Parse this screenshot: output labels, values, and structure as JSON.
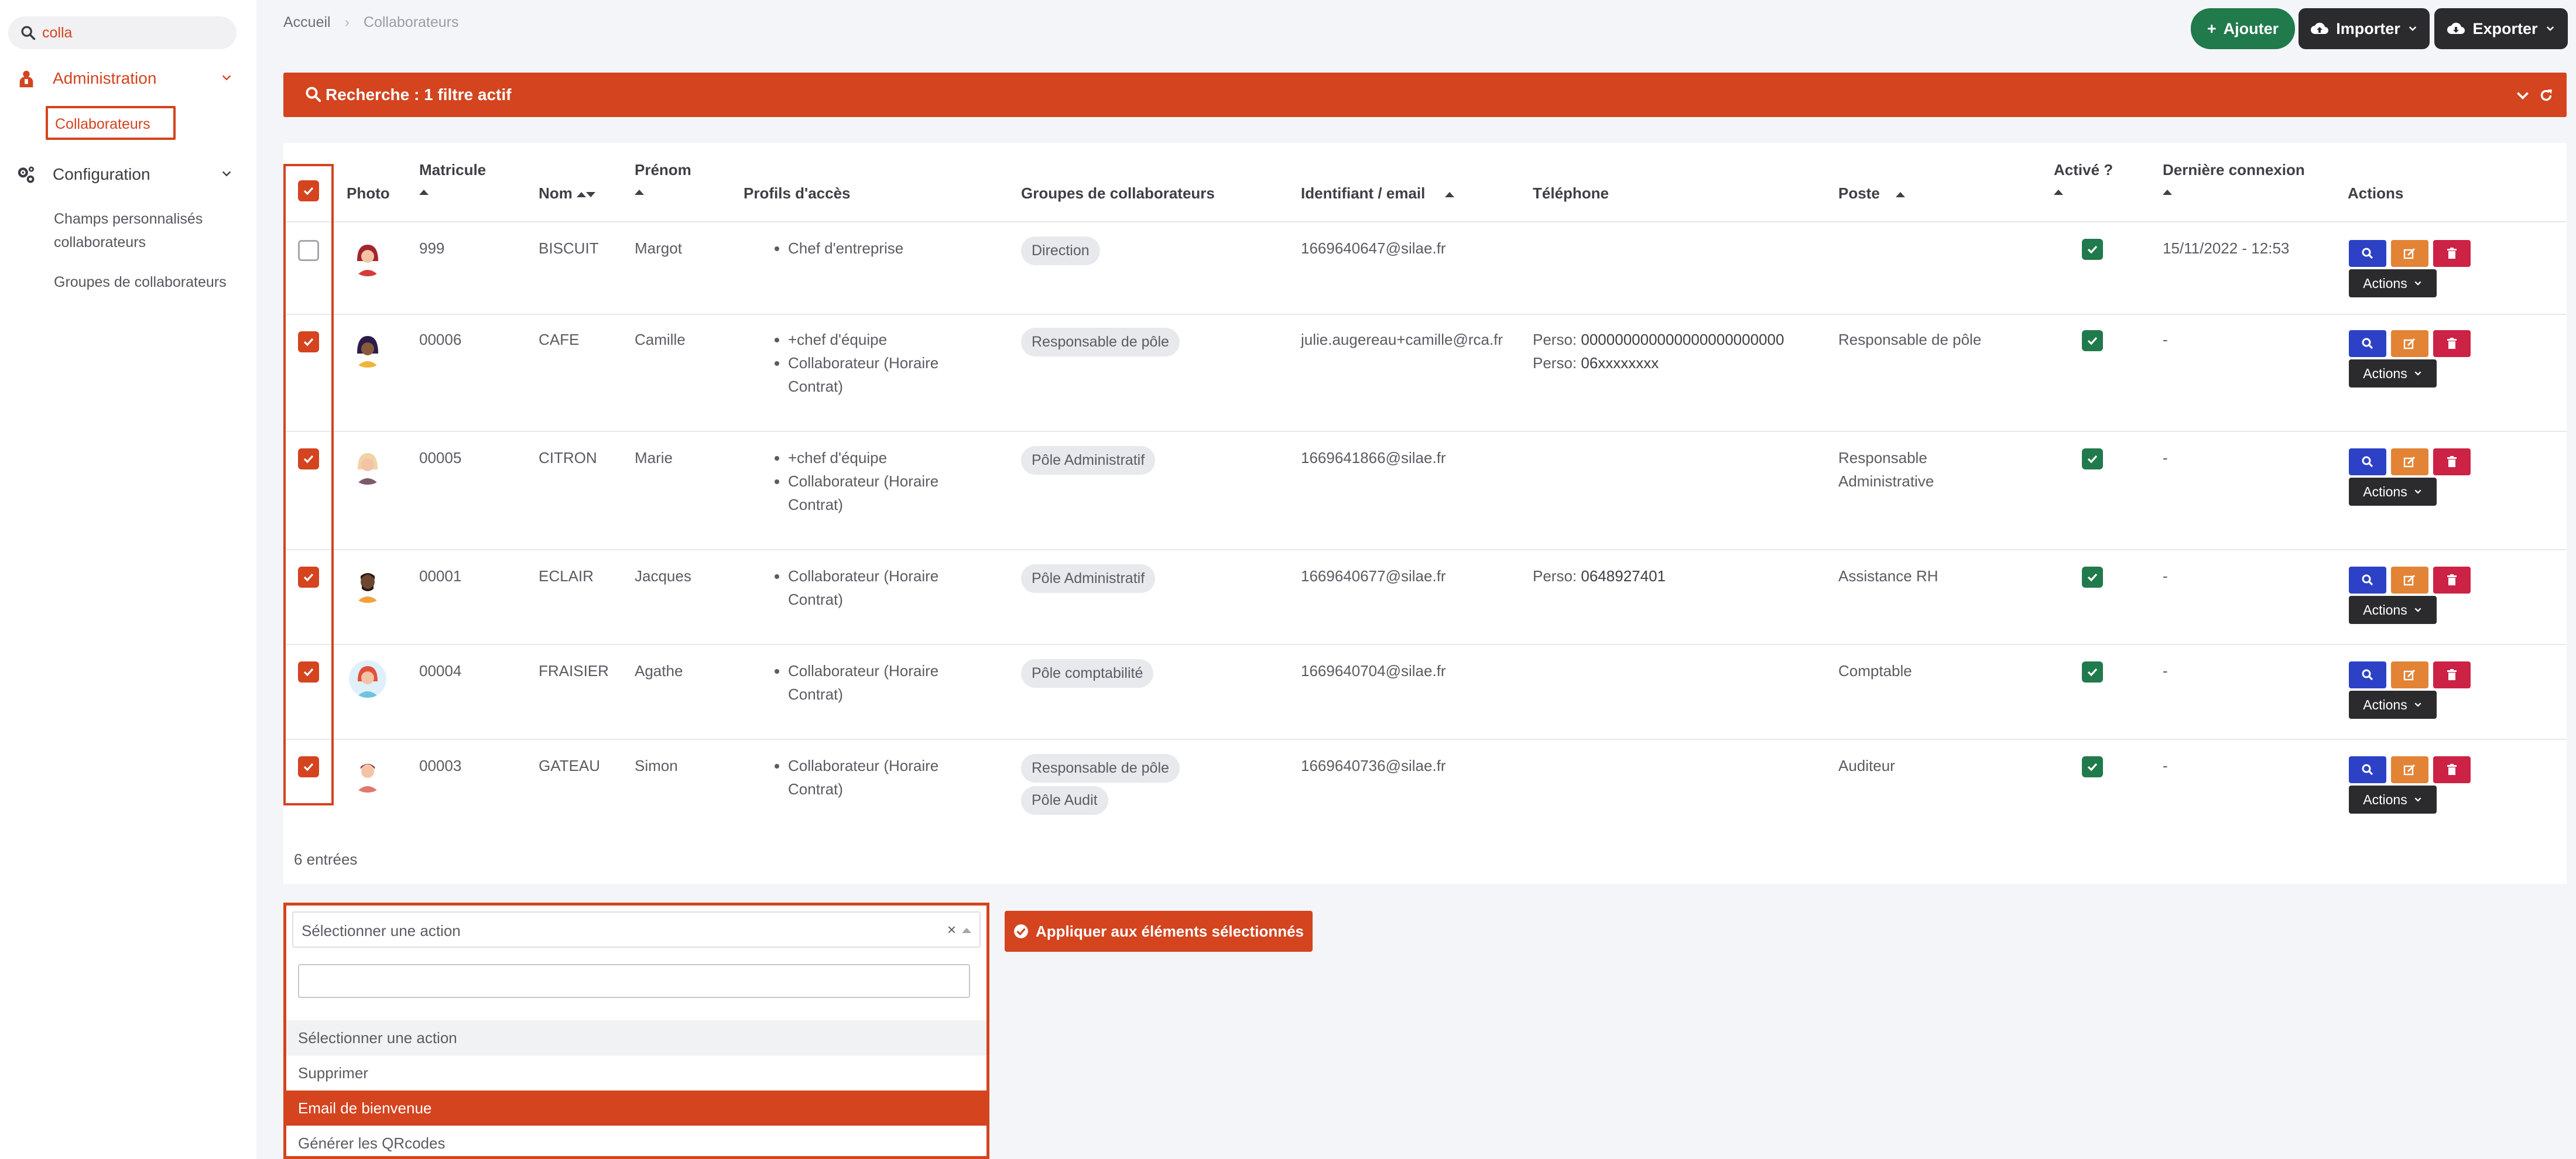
{
  "sidebar": {
    "search_value": "colla",
    "sections": [
      {
        "label": "Administration",
        "icon": "admin-user-icon",
        "color": "#d3441f"
      },
      {
        "label": "Configuration",
        "icon": "gears-icon",
        "color": "#3a3c42"
      }
    ],
    "admin_items": [
      "Collaborateurs"
    ],
    "config_items": [
      "Champs personnalisés collaborateurs",
      "Groupes de collaborateurs"
    ]
  },
  "breadcrumb": {
    "home": "Accueil",
    "current": "Collaborateurs"
  },
  "toolbar": {
    "add_label": "Ajouter",
    "import_label": "Importer",
    "export_label": "Exporter"
  },
  "filter": {
    "label": "Recherche : 1 filtre actif"
  },
  "table": {
    "headers": {
      "photo": "Photo",
      "matricule": "Matricule",
      "nom": "Nom",
      "prenom": "Prénom",
      "profils": "Profils d'accès",
      "groupes": "Groupes de collaborateurs",
      "identifiant": "Identifiant / email",
      "telephone": "Téléphone",
      "poste": "Poste",
      "active": "Activé ?",
      "derniere": "Dernière connexion",
      "actions": "Actions"
    },
    "rows": [
      {
        "selected": false,
        "matricule": "999",
        "nom": "BISCUIT",
        "prenom": "Margot",
        "profils": [
          "Chef d'entreprise"
        ],
        "groupes": [
          "Direction"
        ],
        "email": "1669640647@silae.fr",
        "telephone": [],
        "poste": [
          "",
          ""
        ],
        "derniere": "15/11/2022 - 12:53"
      },
      {
        "selected": true,
        "matricule": "00006",
        "nom": "CAFE",
        "prenom": "Camille",
        "profils": [
          "+chef d'équipe",
          "Collaborateur (Horaire",
          "Contrat)"
        ],
        "groupes": [
          "Responsable de pôle"
        ],
        "email": "julie.augereau+camille@rca.fr",
        "telephone": [
          {
            "label": "Perso:",
            "value": "000000000000000000000000"
          },
          {
            "label": "Perso:",
            "value": "06xxxxxxxx"
          }
        ],
        "poste": [
          "Responsable de pôle",
          ""
        ],
        "derniere": "-"
      },
      {
        "selected": true,
        "matricule": "00005",
        "nom": "CITRON",
        "prenom": "Marie",
        "profils": [
          "+chef d'équipe",
          "Collaborateur (Horaire",
          "Contrat)"
        ],
        "groupes": [
          "Pôle Administratif"
        ],
        "email": "1669641866@silae.fr",
        "telephone": [],
        "poste": [
          "Responsable",
          "Administrative"
        ],
        "derniere": "-"
      },
      {
        "selected": true,
        "matricule": "00001",
        "nom": "ECLAIR",
        "prenom": "Jacques",
        "profils": [
          "Collaborateur (Horaire",
          "Contrat)"
        ],
        "groupes": [
          "Pôle Administratif"
        ],
        "email": "1669640677@silae.fr",
        "telephone": [
          {
            "label": "Perso:",
            "value": "0648927401"
          }
        ],
        "poste": [
          "Assistance RH",
          ""
        ],
        "derniere": "-"
      },
      {
        "selected": true,
        "matricule": "00004",
        "nom": "FRAISIER",
        "prenom": "Agathe",
        "profils": [
          "Collaborateur (Horaire",
          "Contrat)"
        ],
        "groupes": [
          "Pôle comptabilité"
        ],
        "email": "1669640704@silae.fr",
        "telephone": [],
        "poste": [
          "Comptable",
          ""
        ],
        "derniere": "-"
      },
      {
        "selected": true,
        "matricule": "00003",
        "nom": "GATEAU",
        "prenom": "Simon",
        "profils": [
          "Collaborateur (Horaire",
          "Contrat)"
        ],
        "groupes": [
          "Responsable de pôle",
          "Pôle Audit"
        ],
        "email": "1669640736@silae.fr",
        "telephone": [],
        "poste": [
          "Auditeur",
          ""
        ],
        "derniere": "-"
      }
    ],
    "row_actions_label": "Actions",
    "entries_count": "6 entrées"
  },
  "bulk": {
    "placeholder": "Sélectionner une action",
    "clear": "×",
    "options": [
      "Sélectionner une action",
      "Supprimer",
      "Email de bienvenue",
      "Générer les QRcodes"
    ],
    "highlighted_index": 2,
    "apply_label": "Appliquer aux éléments sélectionnés"
  },
  "colors": {
    "accent": "#d3441f",
    "success": "#207a4b",
    "dark": "#2b2b2e",
    "view": "#2c41c6",
    "edit": "#e38335",
    "delete": "#cc2245"
  }
}
